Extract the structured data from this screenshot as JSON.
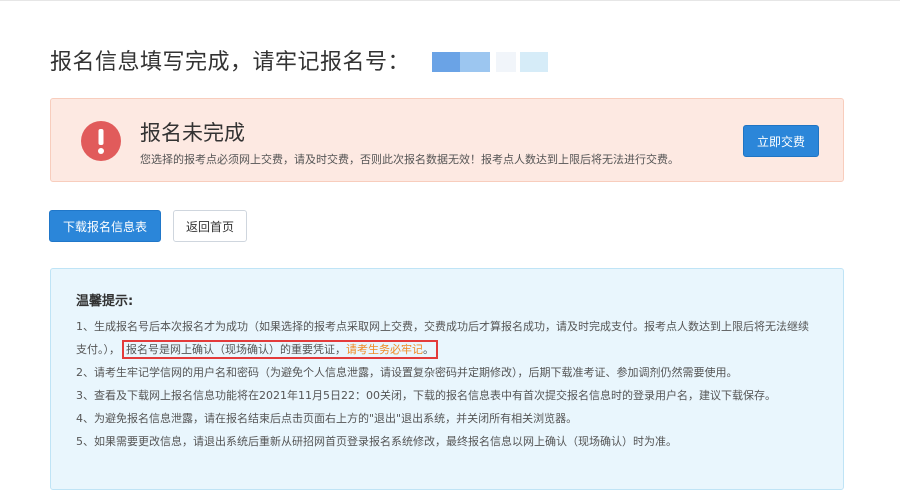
{
  "page": {
    "title": "报名信息填写完成，请牢记报名号："
  },
  "alert": {
    "title": "报名未完成",
    "description": "您选择的报考点必须网上交费，请及时交费，否则此次报名数据无效！报考点人数达到上限后将无法进行交费。",
    "pay_button": "立即交费",
    "icon": "exclamation-circle-icon",
    "bg_color": "#fde9e2",
    "icon_color": "#e15b5b"
  },
  "actions": {
    "download_button": "下载报名信息表",
    "home_button": "返回首页",
    "accent_color": "#2b86d9"
  },
  "tips": {
    "title": "温馨提示:",
    "item1_a": "1、生成报名号后本次报名才为成功（如果选择的报考点采取网上交费，交费成功后才算报名成功，请及时完成支付。报考点人数达到上限后将无法继续支付。），",
    "item1_highlight": "报名号是网上确认（现场确认）的重要凭证，",
    "item1_orange": "请考生务必牢记",
    "item1_end": "。",
    "item2": "2、请考生牢记学信网的用户名和密码（为避免个人信息泄露，请设置复杂密码并定期修改），后期下载准考证、参加调剂仍然需要使用。",
    "item3": "3、查看及下载网上报名信息功能将在2021年11月5日22：00关闭，下载的报名信息表中有首次提交报名信息时的登录用户名，建议下载保存。",
    "item4": "4、为避免报名信息泄露，请在报名结束后点击页面右上方的\"退出\"退出系统，并关闭所有相关浏览器。",
    "item5": "5、如果需要更改信息，请退出系统后重新从研招网首页登录报名系统修改，最终报名信息以网上确认（现场确认）时为准。",
    "bg_color": "#e9f6fd",
    "highlight_border_color": "#e33b3b",
    "orange_color": "#f08a24"
  }
}
